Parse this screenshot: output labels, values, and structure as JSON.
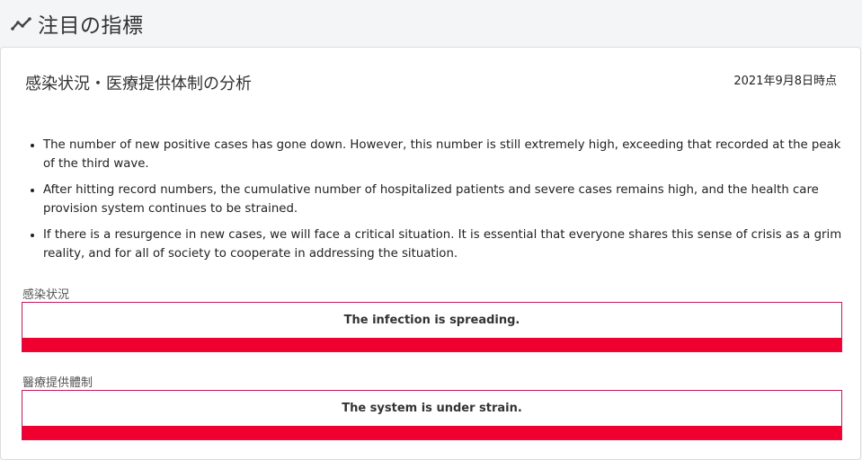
{
  "header": {
    "icon": "trend-line-icon",
    "title": "注目の指標"
  },
  "card": {
    "title": "感染状況・医療提供体制の分析",
    "date": "2021年9月8日時点",
    "bullets": [
      "The number of new positive cases has gone down. However, this number is still extremely high, exceeding that recorded at the peak of the third wave.",
      "After hitting record numbers, the cumulative number of hospitalized patients and severe cases remains high, and the health care provision system continues to be strained.",
      "If there is a resurgence in new cases, we will face a critical situation. It is essential that everyone shares this sense of crisis as a grim reality, and for all of society to cooperate in addressing the situation."
    ],
    "infection": {
      "label": "感染状況",
      "status": "The infection is spreading.",
      "color": "#f0002e"
    },
    "medical": {
      "label": "醫療提供體制",
      "status": "The system is under strain.",
      "color": "#f0002e"
    }
  }
}
